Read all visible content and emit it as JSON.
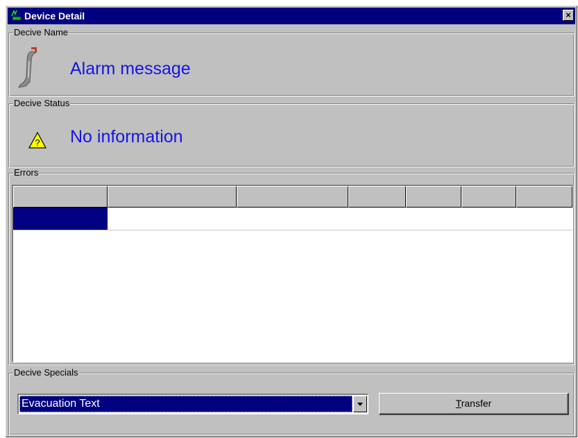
{
  "window": {
    "title": "Device Detail",
    "close_glyph": "×",
    "colors": {
      "titlebar": "#000080",
      "face": "#c0c0c0",
      "accent_text": "#1414e6"
    }
  },
  "device_name": {
    "label": "Decive Name",
    "value": "Alarm message",
    "icon": "device-detector-icon"
  },
  "device_status": {
    "label": "Decive Status",
    "value": "No information",
    "icon": "warning-icon"
  },
  "errors": {
    "label": "Errors",
    "columns": [
      "",
      "",
      "",
      "",
      "",
      "",
      ""
    ],
    "rows": [
      {
        "selected": true,
        "cells": [
          "",
          "",
          "",
          "",
          "",
          "",
          ""
        ]
      }
    ]
  },
  "device_specials": {
    "label": "Decive Specials",
    "selected_option": "Evacuation Text",
    "transfer_button": {
      "accel": "T",
      "rest": "ransfer"
    }
  }
}
